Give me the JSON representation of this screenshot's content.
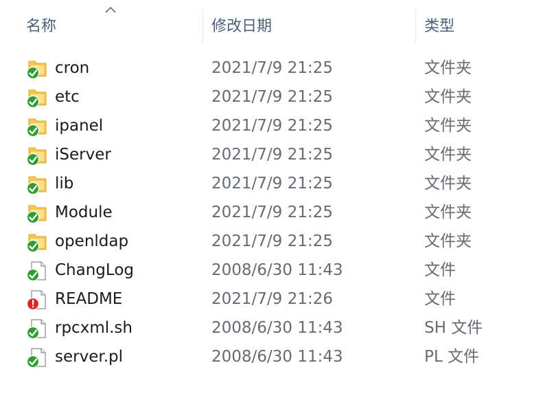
{
  "columns": {
    "name": "名称",
    "modified": "修改日期",
    "type": "类型"
  },
  "sort": {
    "column": "name",
    "direction": "ascending",
    "icon": "chevron-up-icon"
  },
  "files": [
    {
      "name": "cron",
      "modified": "2021/7/9 21:25",
      "type": "文件夹",
      "kind": "folder",
      "status": "synced",
      "icon": "folder-icon"
    },
    {
      "name": "etc",
      "modified": "2021/7/9 21:25",
      "type": "文件夹",
      "kind": "folder",
      "status": "synced",
      "icon": "folder-icon"
    },
    {
      "name": "ipanel",
      "modified": "2021/7/9 21:25",
      "type": "文件夹",
      "kind": "folder",
      "status": "synced",
      "icon": "folder-icon"
    },
    {
      "name": "iServer",
      "modified": "2021/7/9 21:25",
      "type": "文件夹",
      "kind": "folder",
      "status": "synced",
      "icon": "folder-icon"
    },
    {
      "name": "lib",
      "modified": "2021/7/9 21:25",
      "type": "文件夹",
      "kind": "folder",
      "status": "synced",
      "icon": "folder-icon"
    },
    {
      "name": "Module",
      "modified": "2021/7/9 21:25",
      "type": "文件夹",
      "kind": "folder",
      "status": "synced",
      "icon": "folder-icon"
    },
    {
      "name": "openldap",
      "modified": "2021/7/9 21:25",
      "type": "文件夹",
      "kind": "folder",
      "status": "synced",
      "icon": "folder-icon"
    },
    {
      "name": "ChangLog",
      "modified": "2008/6/30 11:43",
      "type": "文件",
      "kind": "file",
      "status": "synced",
      "icon": "file-icon"
    },
    {
      "name": "README",
      "modified": "2021/7/9 21:26",
      "type": "文件",
      "kind": "file",
      "status": "error",
      "icon": "file-icon"
    },
    {
      "name": "rpcxml.sh",
      "modified": "2008/6/30 11:43",
      "type": "SH 文件",
      "kind": "file",
      "status": "synced",
      "icon": "file-icon"
    },
    {
      "name": "server.pl",
      "modified": "2008/6/30 11:43",
      "type": "PL 文件",
      "kind": "file",
      "status": "synced",
      "icon": "file-icon"
    }
  ],
  "colors": {
    "header_text": "#4c607a",
    "folder": "#f6c94e",
    "status_ok": "#2f9e30",
    "status_error": "#e02525"
  }
}
